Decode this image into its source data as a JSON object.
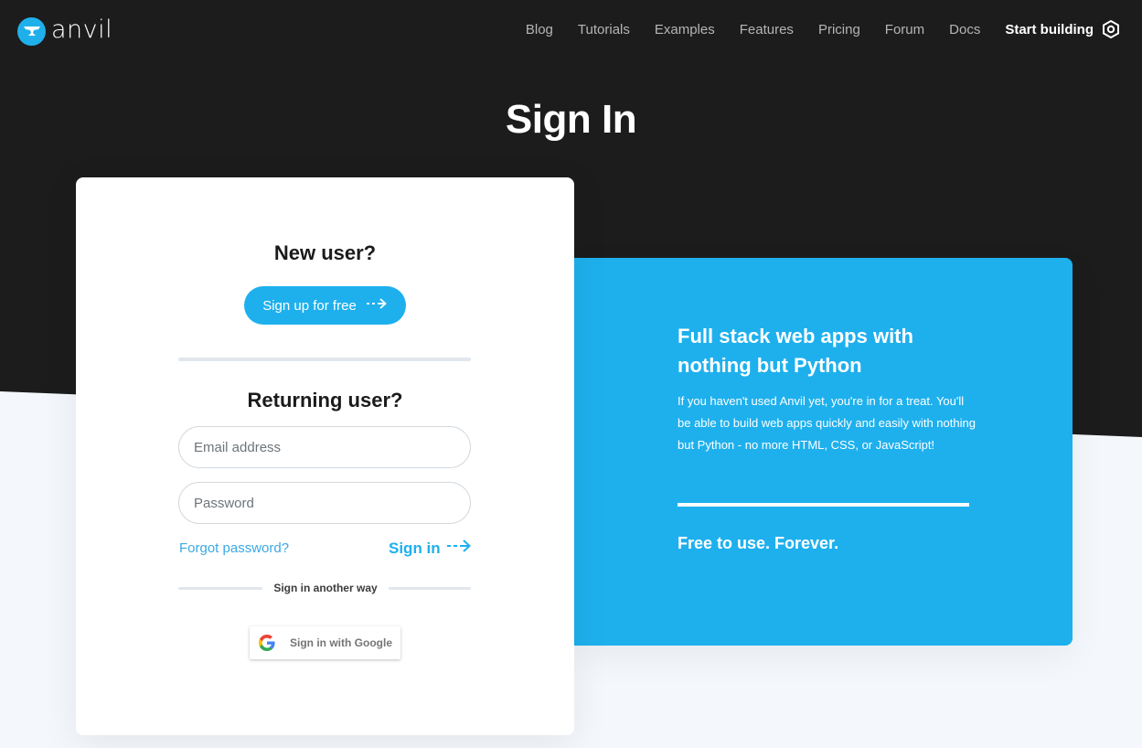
{
  "brand": {
    "name": "anvil"
  },
  "nav": {
    "links": [
      "Blog",
      "Tutorials",
      "Examples",
      "Features",
      "Pricing",
      "Forum",
      "Docs"
    ],
    "cta": "Start building",
    "cta_icon": "hexagon-gear-icon"
  },
  "page": {
    "title": "Sign In"
  },
  "new_user": {
    "heading": "New user?",
    "signup_label": "Sign up for free"
  },
  "returning_user": {
    "heading": "Returning user?",
    "email_placeholder": "Email address",
    "password_placeholder": "Password",
    "forgot_label": "Forgot password?",
    "signin_label": "Sign in",
    "alt_label": "Sign in another way",
    "google_label": "Sign in with Google"
  },
  "promo": {
    "heading": "Full stack web apps with nothing but Python",
    "body": "If you haven't used Anvil yet, you're in for a treat. You'll be able to build web apps quickly and easily with nothing but Python - no more HTML, CSS, or JavaScript!",
    "footer": "Free to use. Forever."
  },
  "colors": {
    "accent": "#1eb0ed",
    "dark_bg": "#1c1c1c",
    "light_bg": "#f4f8fc"
  }
}
